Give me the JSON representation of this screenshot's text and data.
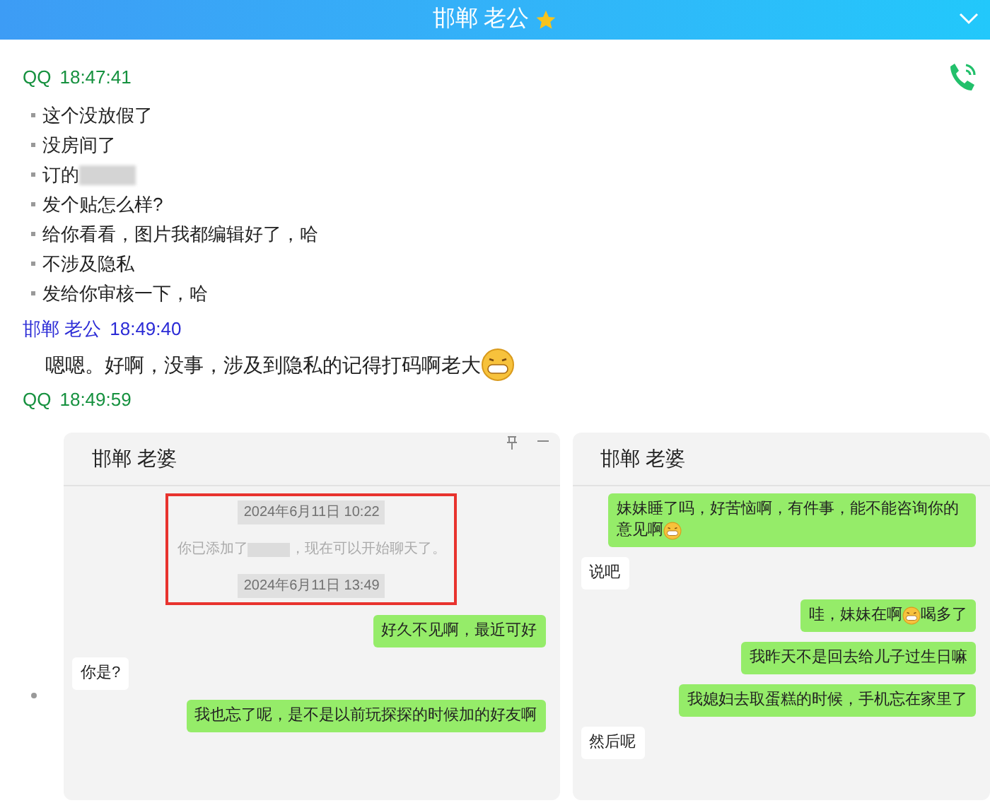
{
  "header": {
    "title": "邯郸 老公"
  },
  "log": [
    {
      "kind": "stamp",
      "sender": "QQ",
      "time": "18:47:41",
      "color": "#16913f"
    },
    {
      "kind": "list",
      "items": [
        {
          "text": "这个没放假了",
          "redacted": false
        },
        {
          "text": "没房间了",
          "redacted": false
        },
        {
          "text": "订的",
          "redacted": true
        },
        {
          "text": "发个贴怎么样?",
          "redacted": false
        },
        {
          "text": "给你看看，图片我都编辑好了，哈",
          "redacted": false
        },
        {
          "text": "不涉及隐私",
          "redacted": false
        },
        {
          "text": "发给你审核一下，哈",
          "redacted": false
        }
      ]
    },
    {
      "kind": "stamp",
      "sender": "邯郸 老公",
      "time": "18:49:40",
      "color": "#2b2bd6"
    },
    {
      "kind": "text",
      "text": "嗯嗯。好啊，没事，涉及到隐私的记得打码啊老大",
      "emoji": true
    },
    {
      "kind": "stamp",
      "sender": "QQ",
      "time": "18:49:59",
      "color": "#16913f"
    },
    {
      "kind": "screenshots",
      "shots": [
        {
          "title": "邯郸 老婆",
          "window_buttons": true,
          "messages": [
            {
              "kind": "system",
              "highlighted": true,
              "items": [
                {
                  "kind": "date",
                  "text": "2024年6月11日 10:22"
                },
                {
                  "kind": "notice",
                  "before": "你已添加了",
                  "after": "，现在可以开始聊天了。"
                },
                {
                  "kind": "date",
                  "text": "2024年6月11日 13:49"
                }
              ]
            },
            {
              "kind": "sent",
              "segments": [
                {
                  "kind": "text",
                  "text": "好久不见啊，最近可好"
                }
              ]
            },
            {
              "kind": "received",
              "segments": [
                {
                  "kind": "text",
                  "text": "你是?"
                }
              ]
            },
            {
              "kind": "sent",
              "segments": [
                {
                  "kind": "text",
                  "text": "我也忘了呢，是不是以前玩探探的时候加的好友啊"
                }
              ]
            }
          ]
        },
        {
          "title": "邯郸 老婆",
          "window_buttons": false,
          "messages": [
            {
              "kind": "sent",
              "segments": [
                {
                  "kind": "text",
                  "text": "妹妹睡了吗，好苦恼啊，有件事，能不能咨询你的意见啊"
                },
                {
                  "kind": "emoji"
                }
              ]
            },
            {
              "kind": "received",
              "segments": [
                {
                  "kind": "text",
                  "text": "说吧"
                }
              ]
            },
            {
              "kind": "sent",
              "segments": [
                {
                  "kind": "text",
                  "text": "哇，妹妹在啊"
                },
                {
                  "kind": "emoji"
                },
                {
                  "kind": "text",
                  "text": "喝多了"
                }
              ]
            },
            {
              "kind": "sent",
              "segments": [
                {
                  "kind": "text",
                  "text": "我昨天不是回去给儿子过生日嘛"
                }
              ]
            },
            {
              "kind": "sent",
              "segments": [
                {
                  "kind": "text",
                  "text": "我媳妇去取蛋糕的时候，手机忘在家里了"
                }
              ]
            },
            {
              "kind": "received",
              "segments": [
                {
                  "kind": "text",
                  "text": "然后呢"
                }
              ]
            }
          ]
        }
      ]
    }
  ]
}
